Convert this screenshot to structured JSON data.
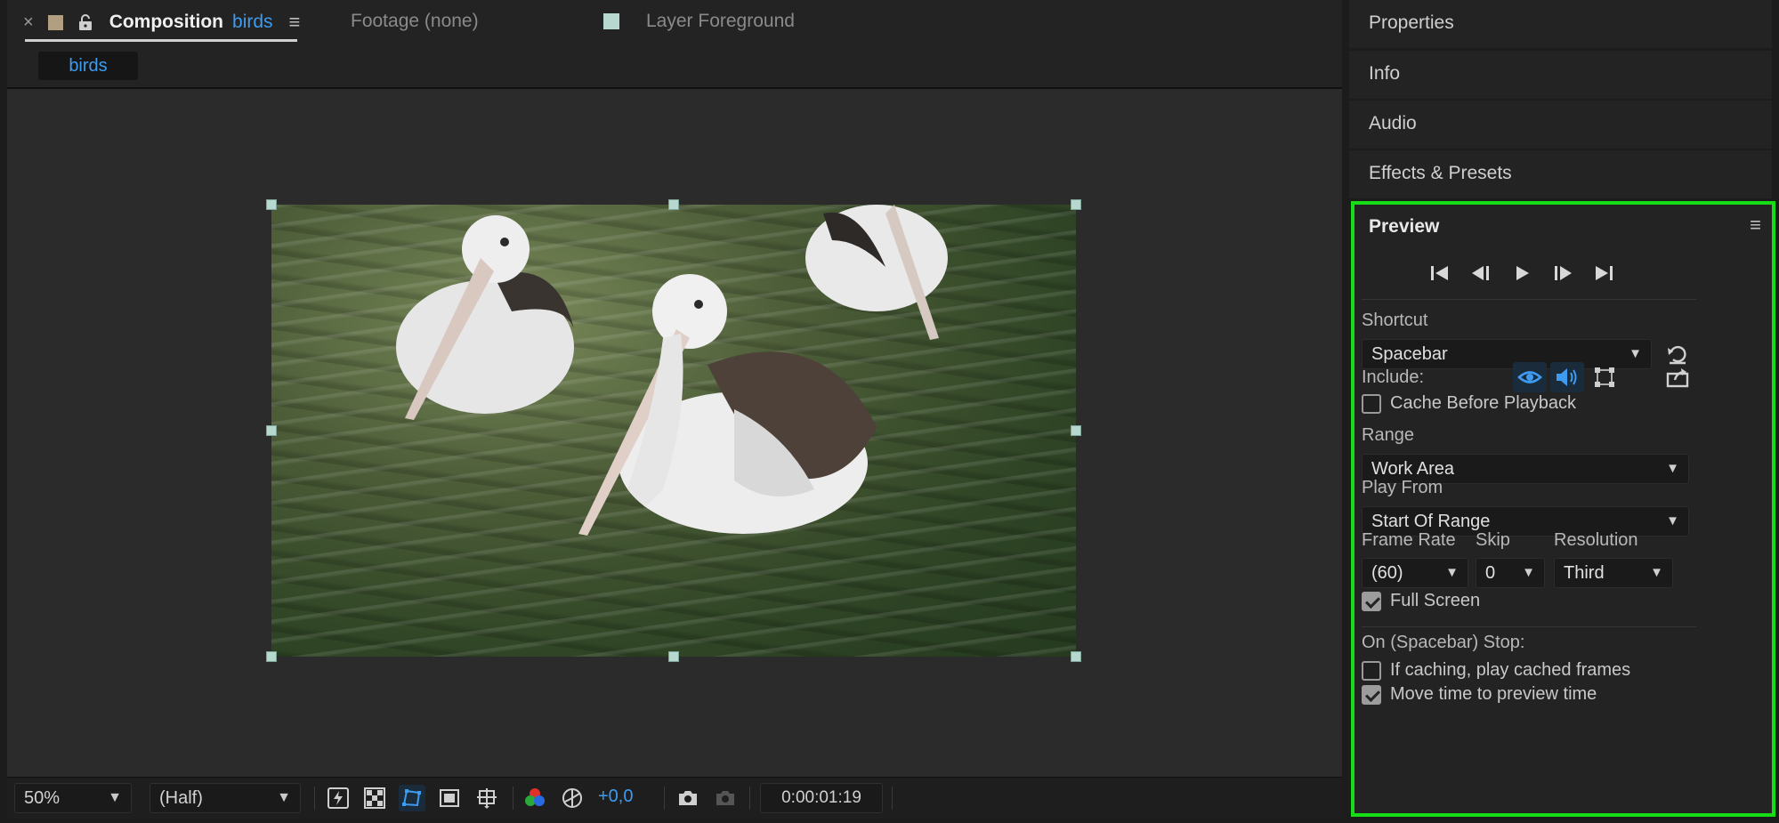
{
  "composition_panel": {
    "tabs": {
      "comp_close": "×",
      "comp_prefix": "Composition",
      "comp_name": "birds",
      "footage": "Footage (none)",
      "layer": "Layer Foreground"
    },
    "comp_name_chip": "birds",
    "toolbar": {
      "zoom": "50%",
      "resolution": "(Half)",
      "exposure": "+0,0",
      "timecode": "0:00:01:19"
    }
  },
  "right_panels": {
    "properties": "Properties",
    "info": "Info",
    "audio": "Audio",
    "effects": "Effects & Presets"
  },
  "preview": {
    "title": "Preview",
    "shortcut_label": "Shortcut",
    "shortcut_value": "Spacebar",
    "include_label": "Include:",
    "cache_before_playback": "Cache Before Playback",
    "cache_before_playback_checked": false,
    "range_label": "Range",
    "range_value": "Work Area",
    "play_from_label": "Play From",
    "play_from_value": "Start Of Range",
    "frame_rate_label": "Frame Rate",
    "frame_rate_value": "(60)",
    "skip_label": "Skip",
    "skip_value": "0",
    "resolution_label": "Resolution",
    "resolution_value": "Third",
    "full_screen": "Full Screen",
    "full_screen_checked": true,
    "on_stop_label": "On (Spacebar) Stop:",
    "if_caching": "If caching, play cached frames",
    "if_caching_checked": false,
    "move_time": "Move time to preview time",
    "move_time_checked": true
  },
  "colors": {
    "accent_blue": "#3d9cf0",
    "highlight_green": "#16dd16",
    "panel_bg": "#232323",
    "handle": "#b7d8cf"
  }
}
